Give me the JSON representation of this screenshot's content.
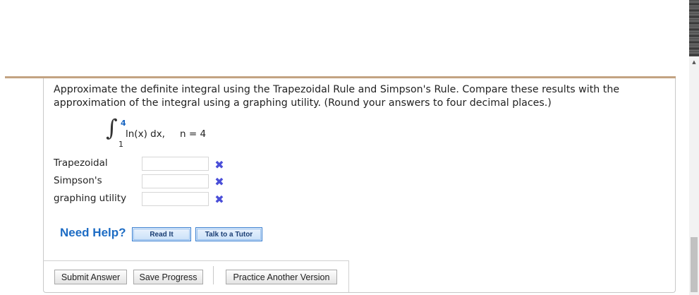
{
  "question": {
    "text": "Approximate the definite integral using the Trapezoidal Rule and Simpson's Rule. Compare these results with the approximation of the integral using a graphing utility. (Round your answers to four decimal places.)"
  },
  "integral": {
    "sign": "∫",
    "upper_limit": "4",
    "lower_limit": "1",
    "integrand": "ln(x) dx,",
    "n_text": "n = 4"
  },
  "answers": [
    {
      "label": "Trapezoidal",
      "value": "",
      "status": "incorrect"
    },
    {
      "label": "Simpson's",
      "value": "",
      "status": "incorrect"
    },
    {
      "label": "graphing utility",
      "value": "",
      "status": "incorrect"
    }
  ],
  "status_icon": {
    "glyph": "✖",
    "name": "incorrect-x-icon",
    "color": "#4a4ed8"
  },
  "help": {
    "title": "Need Help?",
    "read_it": "Read It",
    "talk_to_tutor": "Talk to a Tutor"
  },
  "actions": {
    "submit": "Submit Answer",
    "save": "Save Progress",
    "practice": "Practice Another Version"
  },
  "colors": {
    "accent_rule": "#c3a382",
    "help_blue": "#1d6cc4",
    "incorrect_mark": "#4a4ed8"
  },
  "scrollbar": {
    "arrow": "▲"
  }
}
